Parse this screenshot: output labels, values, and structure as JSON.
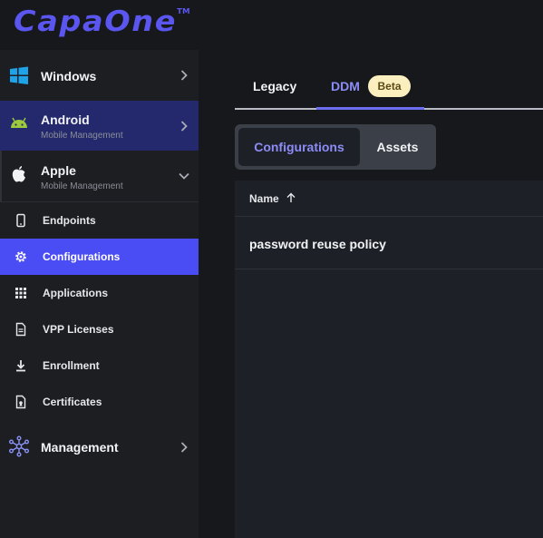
{
  "app": {
    "logo_text": "CapaOne",
    "trademark": "TM",
    "brand_color": "#5b56f0"
  },
  "sidebar": {
    "groups": [
      {
        "key": "windows",
        "title": "Windows",
        "subtitle": "",
        "icon": "windows-icon",
        "chevron": "chevron-right-icon"
      },
      {
        "key": "android",
        "title": "Android",
        "subtitle": "Mobile Management",
        "icon": "android-icon",
        "chevron": "chevron-right-icon",
        "highlighted": true
      },
      {
        "key": "apple",
        "title": "Apple",
        "subtitle": "Mobile Management",
        "icon": "apple-icon",
        "chevron": "chevron-down-icon",
        "expanded": true
      },
      {
        "key": "management",
        "title": "Management",
        "subtitle": "",
        "icon": "network-icon",
        "chevron": "chevron-right-icon"
      }
    ],
    "apple_items": [
      {
        "label": "Endpoints",
        "icon": "phone-icon"
      },
      {
        "label": "Configurations",
        "icon": "gear-icon",
        "active": true
      },
      {
        "label": "Applications",
        "icon": "grid-icon"
      },
      {
        "label": "VPP Licenses",
        "icon": "document-icon"
      },
      {
        "label": "Enrollment",
        "icon": "download-icon"
      },
      {
        "label": "Certificates",
        "icon": "certificate-icon"
      }
    ],
    "active_color": "#4a4cf4",
    "highlight_color": "#24296e"
  },
  "main": {
    "tabs": [
      {
        "label": "Legacy"
      },
      {
        "label": "DDM",
        "badge": "Beta",
        "selected": true
      }
    ],
    "segmented": [
      {
        "label": "Configurations",
        "selected": true
      },
      {
        "label": "Assets"
      }
    ],
    "table": {
      "columns": [
        {
          "label": "Name",
          "sort": "ascending",
          "sort_icon": "arrow-up-icon"
        }
      ],
      "rows": [
        {
          "name": "password reuse policy"
        }
      ]
    },
    "accent_color": "#8c8cf7",
    "badge_color": "#fbefc0"
  }
}
